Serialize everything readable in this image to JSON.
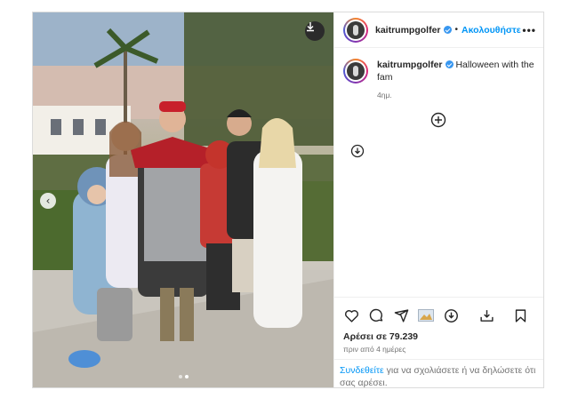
{
  "post": {
    "username": "kaitrumpgolfer",
    "follow_label": "Ακολουθήστε",
    "separator": "•",
    "more_label": "•••",
    "caption_text": "Halloween with the fam",
    "caption_time": "4ημ.",
    "likes_text": "Αρέσει σε 79.239",
    "date_text": "πριν από 4 ημέρες",
    "login_link": "Συνδεθείτε",
    "login_text": " για να σχολιάσετε ή να δηλώσετε ότι σας αρέσει.",
    "carousel": {
      "total": 2,
      "current": 1
    },
    "icons": {
      "download": "download-icon",
      "prev": "chevron-left-icon",
      "like": "heart-icon",
      "comment": "comment-icon",
      "share": "share-icon",
      "save": "bookmark-icon",
      "add": "plus-circle-icon"
    },
    "colors": {
      "accent": "#0095f6",
      "verified": "#3897f0",
      "muted": "#737373"
    }
  }
}
